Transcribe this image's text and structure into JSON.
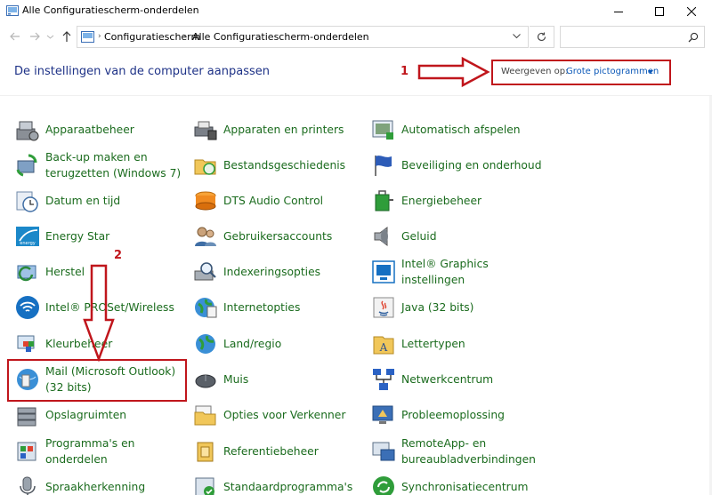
{
  "window": {
    "title": "Alle Configuratiescherm-onderdelen"
  },
  "address": {
    "crumbs": [
      "Configuratiescherm",
      "Alle Configuratiescherm-onderdelen"
    ]
  },
  "search": {
    "placeholder": ""
  },
  "header": {
    "title": "De instellingen van de computer aanpassen",
    "view_label": "Weergeven op:",
    "view_value": "Grote pictogrammen"
  },
  "annotations": {
    "one": "1",
    "two": "2",
    "color": "#c0161c"
  },
  "items": [
    {
      "label": "Apparaatbeheer",
      "icon": "device-manager-icon"
    },
    {
      "label": "Apparaten en printers",
      "icon": "printer-icon"
    },
    {
      "label": "Automatisch afspelen",
      "icon": "autoplay-icon"
    },
    {
      "label": "Back-up maken en terugzetten (Windows 7)",
      "icon": "backup-icon"
    },
    {
      "label": "Bestandsgeschiedenis",
      "icon": "file-history-icon"
    },
    {
      "label": "Beveiliging en onderhoud",
      "icon": "flag-icon"
    },
    {
      "label": "Datum en tijd",
      "icon": "clock-icon"
    },
    {
      "label": "DTS Audio Control",
      "icon": "dts-icon"
    },
    {
      "label": "Energiebeheer",
      "icon": "power-icon"
    },
    {
      "label": "Energy Star",
      "icon": "energy-star-icon"
    },
    {
      "label": "Gebruikersaccounts",
      "icon": "users-icon"
    },
    {
      "label": "Geluid",
      "icon": "speaker-icon"
    },
    {
      "label": "Herstel",
      "icon": "recovery-icon"
    },
    {
      "label": "Indexeringsopties",
      "icon": "indexing-icon"
    },
    {
      "label": "Intel® Graphics instellingen",
      "icon": "intel-graphics-icon"
    },
    {
      "label": "Intel® PROSet/Wireless",
      "icon": "wifi-icon"
    },
    {
      "label": "Internetopties",
      "icon": "globe-icon"
    },
    {
      "label": "Java (32 bits)",
      "icon": "java-icon"
    },
    {
      "label": "Kleurbeheer",
      "icon": "color-management-icon"
    },
    {
      "label": "Land/regio",
      "icon": "region-icon"
    },
    {
      "label": "Lettertypen",
      "icon": "fonts-icon"
    },
    {
      "label": "Mail (Microsoft Outlook) (32 bits)",
      "icon": "mail-icon"
    },
    {
      "label": "Muis",
      "icon": "mouse-icon"
    },
    {
      "label": "Netwerkcentrum",
      "icon": "network-icon"
    },
    {
      "label": "Opslagruimten",
      "icon": "storage-icon"
    },
    {
      "label": "Opties voor Verkenner",
      "icon": "explorer-options-icon"
    },
    {
      "label": "Probleemoplossing",
      "icon": "troubleshoot-icon"
    },
    {
      "label": "Programma's en onderdelen",
      "icon": "programs-icon"
    },
    {
      "label": "Referentiebeheer",
      "icon": "credential-icon"
    },
    {
      "label": "RemoteApp- en bureaubladverbindingen",
      "icon": "remoteapp-icon"
    },
    {
      "label": "Spraakherkenning",
      "icon": "microphone-icon"
    },
    {
      "label": "Standaardprogramma's",
      "icon": "default-programs-icon"
    },
    {
      "label": "Synchronisatiecentrum",
      "icon": "sync-icon"
    }
  ]
}
